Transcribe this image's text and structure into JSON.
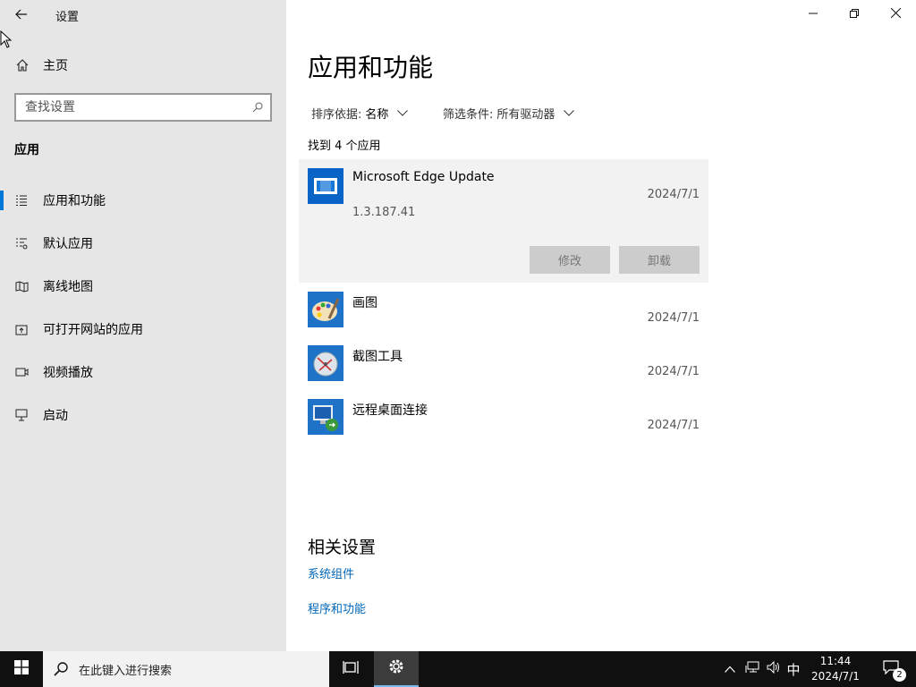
{
  "window": {
    "title": "设置",
    "back_icon": "back-arrow-icon"
  },
  "sidebar": {
    "home_label": "主页",
    "search_placeholder": "查找设置",
    "section": "应用",
    "items": [
      {
        "label": "应用和功能",
        "icon": "apps-list-icon",
        "active": true
      },
      {
        "label": "默认应用",
        "icon": "default-apps-icon",
        "active": false
      },
      {
        "label": "离线地图",
        "icon": "map-icon",
        "active": false
      },
      {
        "label": "可打开网站的应用",
        "icon": "open-website-icon",
        "active": false
      },
      {
        "label": "视频播放",
        "icon": "video-icon",
        "active": false
      },
      {
        "label": "启动",
        "icon": "startup-icon",
        "active": false
      }
    ]
  },
  "main": {
    "title": "应用和功能",
    "sort_label": "排序依据:",
    "sort_value": "名称",
    "filter_label": "筛选条件:",
    "filter_value": "所有驱动器",
    "found_text": "找到 4 个应用",
    "apps": [
      {
        "name": "Microsoft Edge Update",
        "date": "2024/7/1",
        "version": "1.3.187.41",
        "modify": "修改",
        "uninstall": "卸载",
        "selected": true
      },
      {
        "name": "画图",
        "date": "2024/7/1"
      },
      {
        "name": "截图工具",
        "date": "2024/7/1"
      },
      {
        "name": "远程桌面连接",
        "date": "2024/7/1"
      }
    ],
    "related_title": "相关设置",
    "related_links": [
      "系统组件",
      "程序和功能"
    ]
  },
  "taskbar": {
    "search_text": "在此键入进行搜索",
    "ime": "中",
    "time": "11:44",
    "date": "2024/7/1",
    "notification_count": "2"
  },
  "colors": {
    "accent": "#0078d7",
    "link": "#0067b8",
    "sidebar_bg": "#e6e6e6",
    "taskbar_bg": "#101010"
  }
}
